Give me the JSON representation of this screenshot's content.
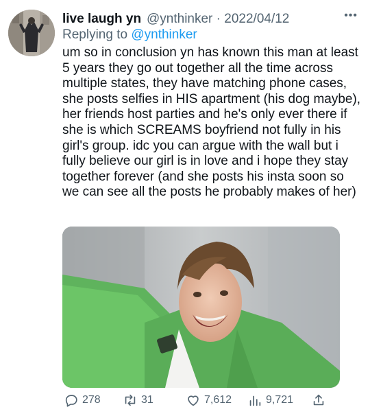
{
  "tweet": {
    "display_name": "live laugh yn",
    "handle": "@ynthinker",
    "separator": "·",
    "date": "2022/04/12",
    "more_label": "•••",
    "replying_prefix": "Replying to",
    "replying_handle": "@ynthinker",
    "text": "um so in conclusion yn has known this man at least 5 years they go out together all the time across multiple states, they have matching phone cases, she posts selfies in HIS apartment (his dog maybe), her friends host parties and he's only ever there if she is which SCREAMS boyfriend not fully in his girl's group. idc you can argue with the wall but i fully believe our girl is in love and i hope they stay together forever (and she posts his insta soon so we can see all the posts he probably makes of her)"
  },
  "actions": {
    "replies": "278",
    "retweets": "31",
    "likes": "7,612",
    "views": "9,721"
  },
  "icons": {
    "reply": "reply-bubble-icon",
    "retweet": "retweet-icon",
    "like": "heart-icon",
    "views": "views-bars-icon",
    "share": "share-icon"
  },
  "colors": {
    "link": "#1d9bf0",
    "secondary": "#536471",
    "primary_text": "#0f1419"
  }
}
